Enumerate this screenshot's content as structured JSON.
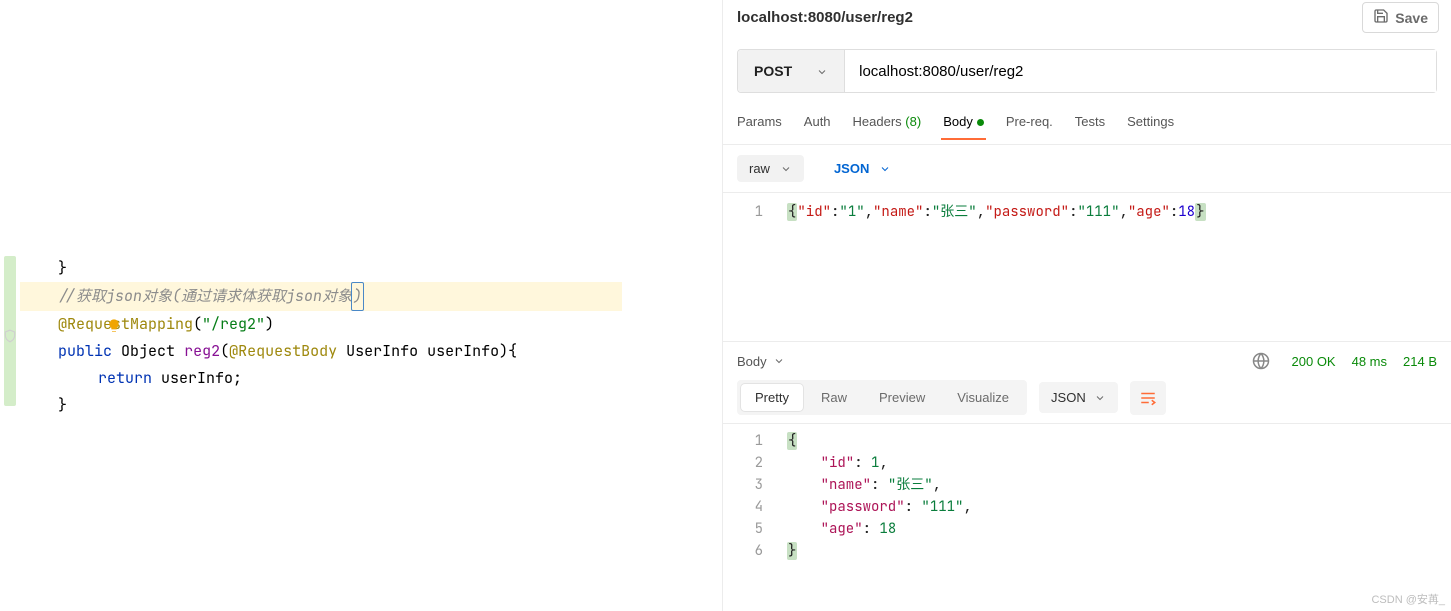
{
  "editor": {
    "close_brace": "}",
    "comment": "//获取json对象(通过请求体获取json对象",
    "caret_char": ")",
    "anno_name": "@RequestMapping",
    "anno_open": "(",
    "anno_arg": "\"/reg2\"",
    "anno_close": ")",
    "method_sig": {
      "kw_public": "public",
      "type_object": "Object",
      "name": "reg2",
      "open": "(",
      "anno_body": "@RequestBody",
      "param_type": "UserInfo",
      "param_name": "userInfo",
      "close": "){"
    },
    "ret_kw": "return",
    "ret_expr": "userInfo;",
    "method_close": "}"
  },
  "request": {
    "title": "localhost:8080/user/reg2",
    "save_label": "Save",
    "method": "POST",
    "url": "localhost:8080/user/reg2",
    "tabs": [
      {
        "label": "Params"
      },
      {
        "label": "Auth"
      },
      {
        "label": "Headers",
        "count": "(8)",
        "count_color": true
      },
      {
        "label": "Body",
        "active": true,
        "dot": true
      },
      {
        "label": "Pre-req."
      },
      {
        "label": "Tests"
      },
      {
        "label": "Settings"
      }
    ],
    "body_mode_label": "raw",
    "body_lang_label": "JSON",
    "body_code": [
      "{\"id\":\"1\",\"name\":\"张三\",\"password\":\"111\",\"age\":18}"
    ]
  },
  "response": {
    "section_label": "Body",
    "status": "200 OK",
    "time": "48 ms",
    "size": "214 B",
    "view_tabs": [
      "Pretty",
      "Raw",
      "Preview",
      "Visualize"
    ],
    "active_view": "Pretty",
    "format_label": "JSON",
    "code_lines": [
      {
        "n": 1,
        "raw": "{",
        "pretty_html": "<span class=\"hl-brace\">{</span>"
      },
      {
        "n": 2,
        "raw": "    \"id\": 1,",
        "pretty_html": "    <span class=\"rj-key\">\"id\"</span>: <span class=\"rj-num\">1</span>,"
      },
      {
        "n": 3,
        "raw": "    \"name\": \"张三\",",
        "pretty_html": "    <span class=\"rj-key\">\"name\"</span>: <span class=\"rj-str\">\"张三\"</span>,"
      },
      {
        "n": 4,
        "raw": "    \"password\": \"111\",",
        "pretty_html": "    <span class=\"rj-key\">\"password\"</span>: <span class=\"rj-str\">\"111\"</span>,"
      },
      {
        "n": 5,
        "raw": "    \"age\": 18",
        "pretty_html": "    <span class=\"rj-key\">\"age\"</span>: <span class=\"rj-num\">18</span>"
      },
      {
        "n": 6,
        "raw": "}",
        "pretty_html": "<span class=\"hl-brace\">}</span>"
      }
    ]
  },
  "watermark": "CSDN @安苒_"
}
